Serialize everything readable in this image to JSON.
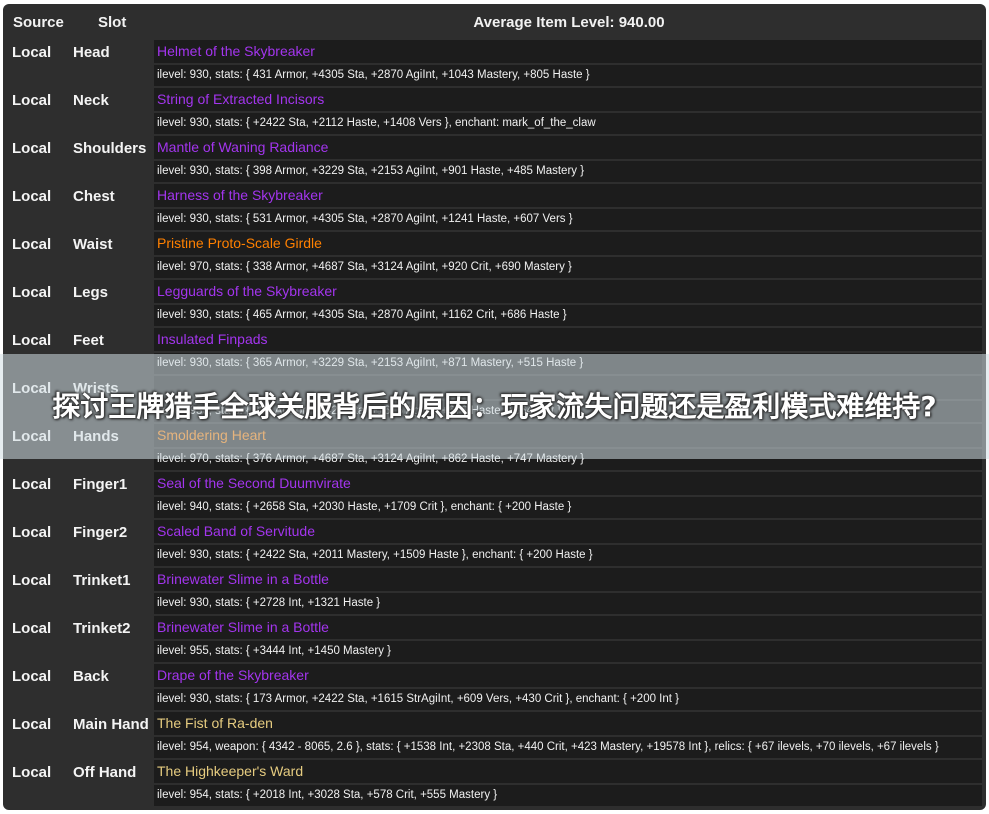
{
  "header": {
    "source_label": "Source",
    "slot_label": "Slot",
    "avg_label": "Average Item Level: 940.00"
  },
  "colors": {
    "epic": "#a335ee",
    "legendary": "#ff8000",
    "artifact": "#e6cc80",
    "text": "#f0f0f0",
    "cell_bg": "#1c1c1c",
    "panel_bg": "#2e2e2e"
  },
  "rows": [
    {
      "source": "Local",
      "slot": "Head",
      "name": "Helmet of the Skybreaker",
      "quality": "epic",
      "stats": "ilevel: 930, stats: { 431 Armor, +4305 Sta, +2870 AgiInt, +1043 Mastery, +805 Haste }"
    },
    {
      "source": "Local",
      "slot": "Neck",
      "name": "String of Extracted Incisors",
      "quality": "epic",
      "stats": "ilevel: 930, stats: { +2422 Sta, +2112 Haste, +1408 Vers }, enchant: mark_of_the_claw"
    },
    {
      "source": "Local",
      "slot": "Shoulders",
      "name": "Mantle of Waning Radiance",
      "quality": "epic",
      "stats": "ilevel: 930, stats: { 398 Armor, +3229 Sta, +2153 AgiInt, +901 Haste, +485 Mastery }"
    },
    {
      "source": "Local",
      "slot": "Chest",
      "name": "Harness of the Skybreaker",
      "quality": "epic",
      "stats": "ilevel: 930, stats: { 531 Armor, +4305 Sta, +2870 AgiInt, +1241 Haste, +607 Vers }"
    },
    {
      "source": "Local",
      "slot": "Waist",
      "name": "Pristine Proto-Scale Girdle",
      "quality": "legendary",
      "stats": "ilevel: 970, stats: { 338 Armor, +4687 Sta, +3124 AgiInt, +920 Crit, +690 Mastery }"
    },
    {
      "source": "Local",
      "slot": "Legs",
      "name": "Legguards of the Skybreaker",
      "quality": "epic",
      "stats": "ilevel: 930, stats: { 465 Armor, +4305 Sta, +2870 AgiInt, +1162 Crit, +686 Haste }"
    },
    {
      "source": "Local",
      "slot": "Feet",
      "name": "Insulated Finpads",
      "quality": "epic",
      "stats": "ilevel: 930, stats: { 365 Armor, +3229 Sta, +2153 AgiInt, +871 Mastery, +515 Haste }"
    },
    {
      "source": "Local",
      "slot": "Wrists",
      "name": "",
      "quality": "epic",
      "stats": "ilevel: 930, stats: { 232 Armor, +2422 Sta, +1615 AgiInt, +676 Haste, +364 Crit }"
    },
    {
      "source": "Local",
      "slot": "Hands",
      "name": "Smoldering Heart",
      "quality": "legendary",
      "stats": "ilevel: 970, stats: { 376 Armor, +4687 Sta, +3124 AgiInt, +862 Haste, +747 Mastery }"
    },
    {
      "source": "Local",
      "slot": "Finger1",
      "name": "Seal of the Second Duumvirate",
      "quality": "epic",
      "stats": "ilevel: 940, stats: { +2658 Sta, +2030 Haste, +1709 Crit }, enchant: { +200 Haste }"
    },
    {
      "source": "Local",
      "slot": "Finger2",
      "name": "Scaled Band of Servitude",
      "quality": "epic",
      "stats": "ilevel: 930, stats: { +2422 Sta, +2011 Mastery, +1509 Haste }, enchant: { +200 Haste }"
    },
    {
      "source": "Local",
      "slot": "Trinket1",
      "name": "Brinewater Slime in a Bottle",
      "quality": "epic",
      "stats": "ilevel: 930, stats: { +2728 Int, +1321 Haste }"
    },
    {
      "source": "Local",
      "slot": "Trinket2",
      "name": "Brinewater Slime in a Bottle",
      "quality": "epic",
      "stats": "ilevel: 955, stats: { +3444 Int, +1450 Mastery }"
    },
    {
      "source": "Local",
      "slot": "Back",
      "name": "Drape of the Skybreaker",
      "quality": "epic",
      "stats": "ilevel: 930, stats: { 173 Armor, +2422 Sta, +1615 StrAgiInt, +609 Vers, +430 Crit }, enchant: { +200 Int }"
    },
    {
      "source": "Local",
      "slot": "Main Hand",
      "name": "The Fist of Ra-den",
      "quality": "artifact",
      "stats": "ilevel: 954, weapon: { 4342 - 8065, 2.6 }, stats: { +1538 Int, +2308 Sta, +440 Crit, +423 Mastery, +19578 Int }, relics: { +67 ilevels, +70 ilevels, +67 ilevels }"
    },
    {
      "source": "Local",
      "slot": "Off Hand",
      "name": "The Highkeeper's Ward",
      "quality": "artifact",
      "stats": "ilevel: 954, stats: { +2018 Int, +3028 Sta, +578 Crit, +555 Mastery }"
    }
  ],
  "banner": {
    "text": "探讨王牌猎手全球关服背后的原因：玩家流失问题还是盈利模式难维持?"
  }
}
